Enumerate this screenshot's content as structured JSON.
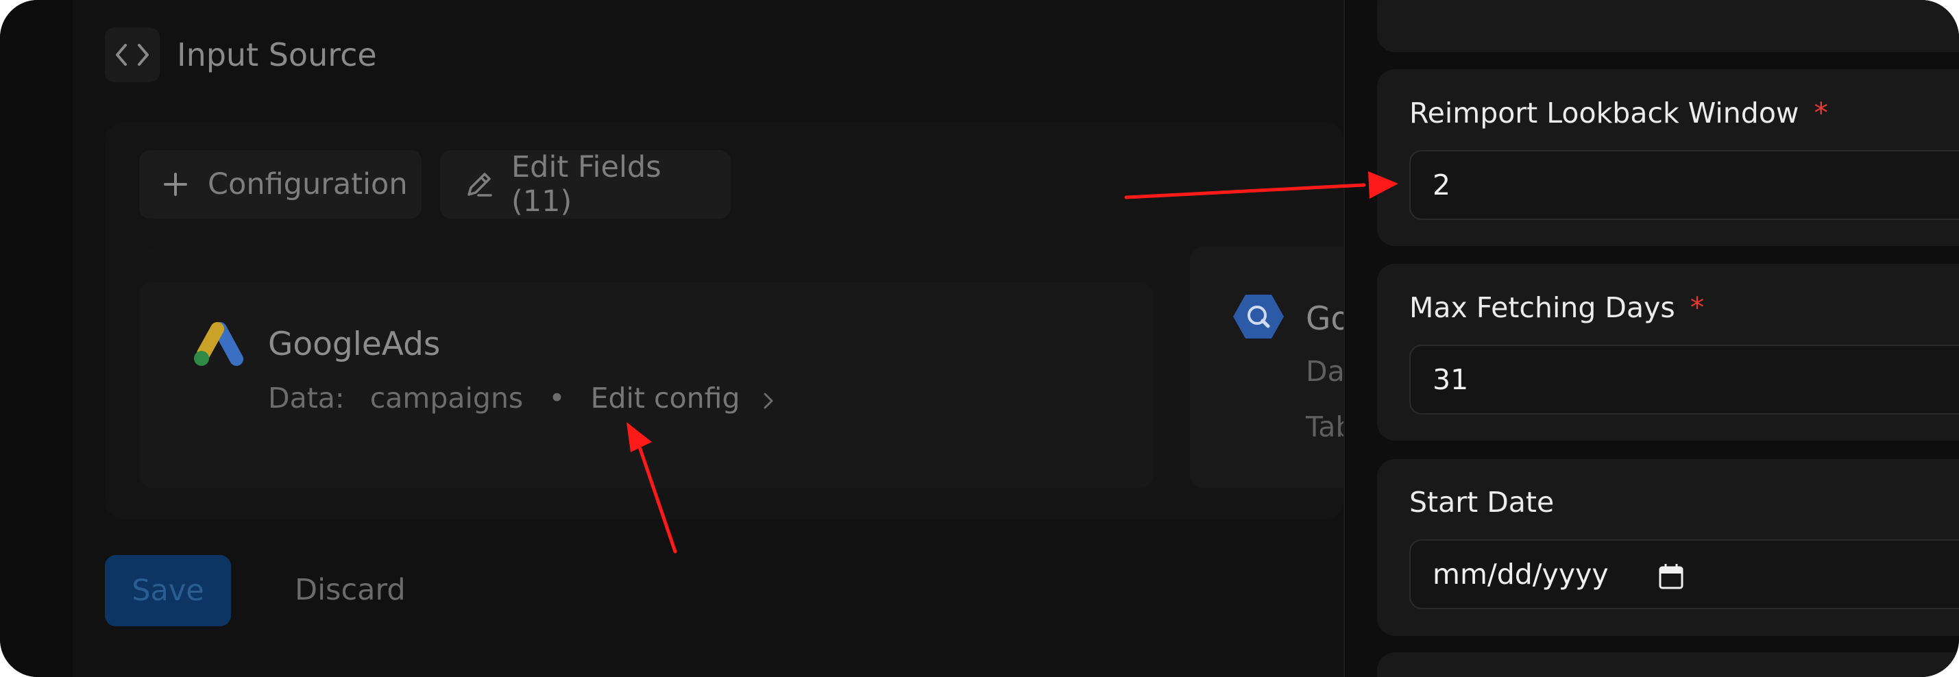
{
  "header": {
    "icon": "code-icon",
    "title": "Input Source"
  },
  "toolbar": {
    "configuration_label": "Configuration",
    "configuration_icon": "plus-icon",
    "edit_fields_label": "Edit Fields (11)",
    "edit_fields_icon": "pencil-icon"
  },
  "sources": [
    {
      "name": "GoogleAds",
      "icon": "google-ads-logo",
      "data_label": "Data:",
      "data_value": "campaigns",
      "separator": "•",
      "edit_label": "Edit config"
    },
    {
      "name": "Go",
      "icon": "bigquery-logo",
      "line1": "Da",
      "line2": "Tab"
    }
  ],
  "actions": {
    "save_label": "Save",
    "discard_label": "Discard"
  },
  "panel": {
    "fields": [
      {
        "label": "Reimport Lookback Window",
        "required": "*",
        "value": "2"
      },
      {
        "label": "Max Fetching Days",
        "required": "*",
        "value": "31"
      },
      {
        "label": "Start Date",
        "required": "",
        "value": "mm/dd/yyyy"
      }
    ]
  },
  "colors": {
    "required": "#e53935",
    "annotation_arrow": "#ff1a1a",
    "save_button": "#0d3563"
  }
}
